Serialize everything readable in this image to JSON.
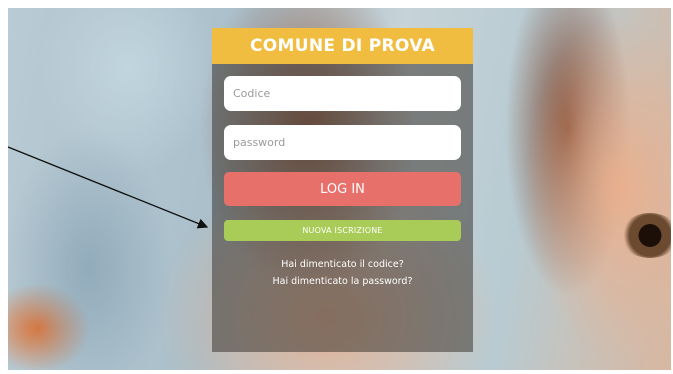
{
  "header": {
    "brand_title": "COMUNE DI PROVA"
  },
  "login_form": {
    "code_placeholder": "Codice",
    "password_placeholder": "password",
    "login_label": "LOG IN",
    "new_registration_label": "NUOVA ISCRIZIONE",
    "forgot_code_label": "Hai dimenticato il codice?",
    "forgot_password_label": "Hai dimenticato la password?"
  },
  "colors": {
    "brand_bar": "#f1bd41",
    "login_button": "#e8706a",
    "new_registration_button": "#a9cb57",
    "panel_overlay": "rgba(60,55,50,0.55)"
  }
}
